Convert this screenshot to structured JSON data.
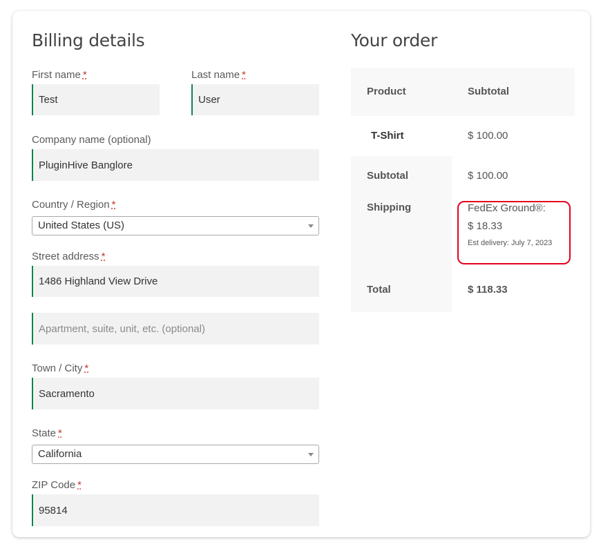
{
  "billing": {
    "title": "Billing details",
    "first_name": {
      "label": "First name",
      "required": "*",
      "value": "Test"
    },
    "last_name": {
      "label": "Last name",
      "required": "*",
      "value": "User"
    },
    "company": {
      "label": "Company name (optional)",
      "value": "PluginHive Banglore"
    },
    "country": {
      "label": "Country / Region",
      "required": "*",
      "value": "United States (US)"
    },
    "street": {
      "label": "Street address",
      "required": "*",
      "value": "1486 Highland View Drive"
    },
    "apartment": {
      "placeholder": "Apartment, suite, unit, etc. (optional)"
    },
    "city": {
      "label": "Town / City",
      "required": "*",
      "value": "Sacramento"
    },
    "state": {
      "label": "State",
      "required": "*",
      "value": "California"
    },
    "zip": {
      "label": "ZIP Code",
      "required": "*",
      "value": "95814"
    }
  },
  "order": {
    "title": "Your order",
    "header": {
      "product": "Product",
      "subtotal": "Subtotal"
    },
    "item": {
      "name": "T-Shirt",
      "price": "$ 100.00"
    },
    "subtotal": {
      "label": "Subtotal",
      "value": "$ 100.00"
    },
    "shipping": {
      "label": "Shipping",
      "method": "FedEx Ground®:",
      "cost": "$ 18.33",
      "delivery": "Est delivery: July 7, 2023"
    },
    "total": {
      "label": "Total",
      "value": "$ 118.33"
    }
  },
  "colors": {
    "field_accent": "#0f834d",
    "required": "#c0392b",
    "highlight": "#e3001b"
  }
}
